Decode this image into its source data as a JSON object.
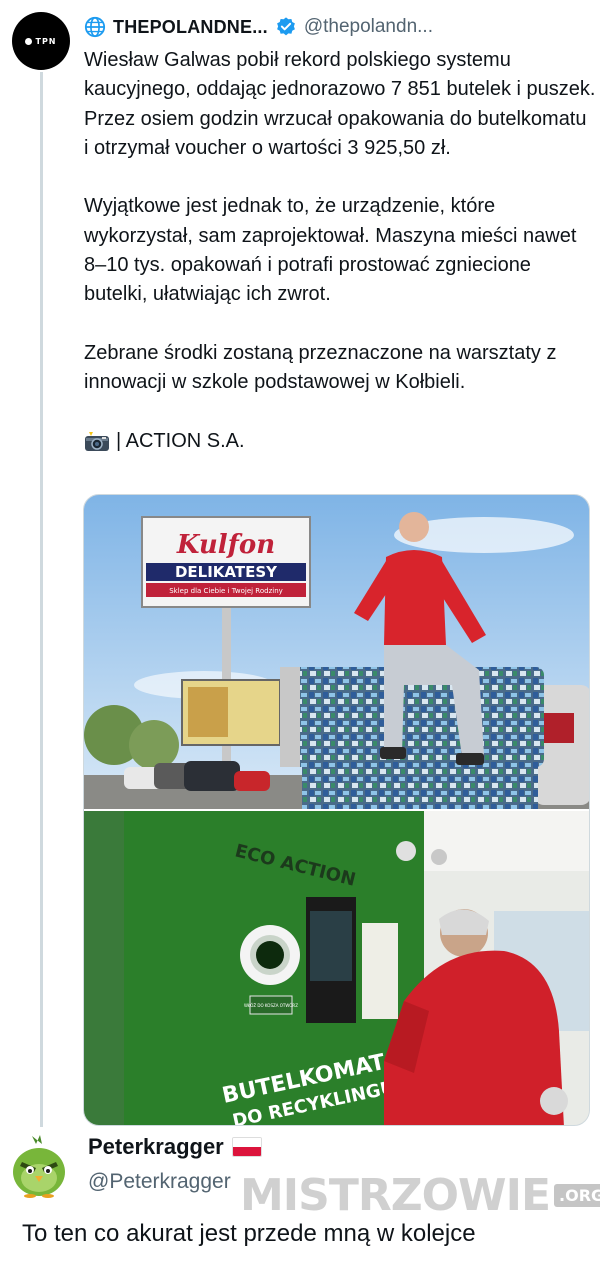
{
  "tweet": {
    "author_name": "THEPOLANDNE...",
    "author_handle": "@thepolandn...",
    "avatar_text": "TPN",
    "paragraphs": [
      "Wiesław Galwas pobił rekord polskiego systemu kaucyjnego, oddając jednorazowo 7 851 butelek i puszek. Przez osiem godzin wrzucał opakowania do butelkomatu i otrzymał voucher o wartości 3 925,50 zł.",
      "Wyjątkowe jest jednak to, że urządzenie, które wykorzystał, sam zaprojektował. Maszyna mieści nawet 8–10 tys. opakowań i potrafi prostować zgniecione butelki, ułatwiając ich zwrot.",
      "Zebrane środki zostaną przeznaczone na warsztaty z innowacji w szkole podstawowej w Kołbieli."
    ],
    "credit": "| ACTION S.A.",
    "photo1": {
      "sign_brand": "Kulfon",
      "sign_title": "DELIKATESY",
      "sign_sub": "Sklep dla Ciebie i Twojej Rodziny"
    },
    "photo2": {
      "machine_brand": "ECO ACTION",
      "machine_label_1": "BUTELKOMAT",
      "machine_label_2": "DO RECYKLINGU",
      "slot_label": "WŁÓŻ DO KOSZA OTWÓRZ"
    }
  },
  "reply": {
    "name": "Peterkragger",
    "handle": "@Peterkragger",
    "text": "To ten co akurat jest przede mną w kolejce"
  },
  "watermark": {
    "text": "MISTRZOWIE",
    "suffix": ".ORG"
  },
  "colors": {
    "verified": "#1d9bf0",
    "handle_gray": "#536471",
    "flag_red": "#dc143c",
    "machine_green": "#2f8a2e"
  }
}
